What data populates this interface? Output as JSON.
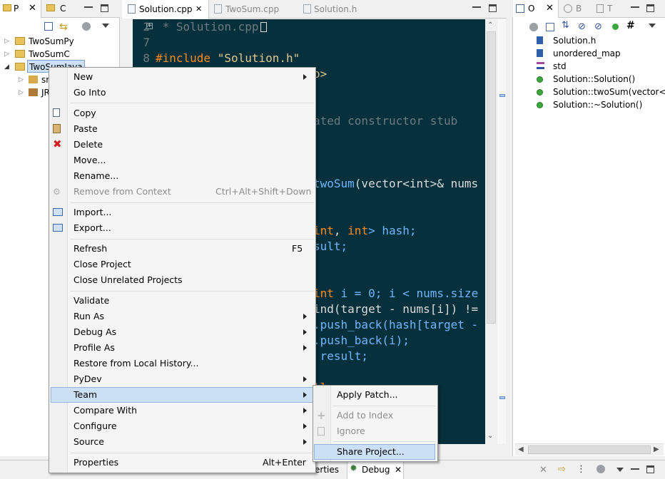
{
  "project_explorer": {
    "tabs": [
      {
        "label": "P"
      },
      {
        "label": "C"
      }
    ],
    "tree": [
      {
        "label": "TwoSumPy"
      },
      {
        "label": "TwoSumC"
      },
      {
        "label": "TwoSumJava"
      },
      {
        "label": "sr"
      },
      {
        "label": "JR"
      }
    ]
  },
  "editor": {
    "tabs": [
      {
        "label": "Solution.cpp"
      },
      {
        "label": "TwoSum.cpp"
      },
      {
        "label": "Solution.h"
      }
    ],
    "line_numbers": [
      "2",
      "7",
      "8"
    ],
    "lines": {
      "l1": " * Solution.cpp",
      "l2_kw": "#include",
      "l2_str": " \"Solution.h\"",
      "l3": "o>",
      "l4": "ated constructor stub",
      "l5_fn": "twoSum",
      "l5_rest": "(vector<int>& nums",
      "l6_kw1": "int",
      "l6_mid": ", ",
      "l6_kw2": "int",
      "l6_rest": "> hash;",
      "l7": "sult;",
      "l8_kw": "int",
      "l8_rest": " i = 0; i < nums.size",
      "l9": "ind(target - nums[i]) !=",
      "l10": ".push_back(hash[target -",
      "l11": ".push_back(i);",
      "l12": " result;",
      "l13": "ll;"
    }
  },
  "outline": {
    "tabs": [
      {
        "label": "O"
      },
      {
        "label": "B"
      },
      {
        "label": "T"
      }
    ],
    "items": [
      {
        "label": "Solution.h"
      },
      {
        "label": "unordered_map"
      },
      {
        "label": "std"
      },
      {
        "label": "Solution::Solution()"
      },
      {
        "label": "Solution::twoSum(vector<in"
      },
      {
        "label": "Solution::~Solution()"
      }
    ]
  },
  "bottom": {
    "tab_partial": "erties",
    "debug_tab": "Debug"
  },
  "context_menu": {
    "items": [
      {
        "label": "New"
      },
      {
        "label": "Go Into"
      },
      {
        "label": "Copy"
      },
      {
        "label": "Paste"
      },
      {
        "label": "Delete"
      },
      {
        "label": "Move..."
      },
      {
        "label": "Rename..."
      },
      {
        "label": "Remove from Context",
        "shortcut": "Ctrl+Alt+Shift+Down"
      },
      {
        "label": "Import..."
      },
      {
        "label": "Export..."
      },
      {
        "label": "Refresh",
        "shortcut": "F5"
      },
      {
        "label": "Close Project"
      },
      {
        "label": "Close Unrelated Projects"
      },
      {
        "label": "Validate"
      },
      {
        "label": "Run As"
      },
      {
        "label": "Debug As"
      },
      {
        "label": "Profile As"
      },
      {
        "label": "Restore from Local History..."
      },
      {
        "label": "PyDev"
      },
      {
        "label": "Team"
      },
      {
        "label": "Compare With"
      },
      {
        "label": "Configure"
      },
      {
        "label": "Source"
      },
      {
        "label": "Properties",
        "shortcut": "Alt+Enter"
      }
    ]
  },
  "team_submenu": {
    "items": [
      {
        "label": "Apply Patch..."
      },
      {
        "label": "Add to Index"
      },
      {
        "label": "Ignore"
      },
      {
        "label": "Share Project..."
      }
    ]
  },
  "colors": {
    "editor_bg": "#05303c",
    "menu_highlight": "#cce0f5",
    "keyword": "#ff8c1a",
    "function": "#6fb6ff"
  }
}
